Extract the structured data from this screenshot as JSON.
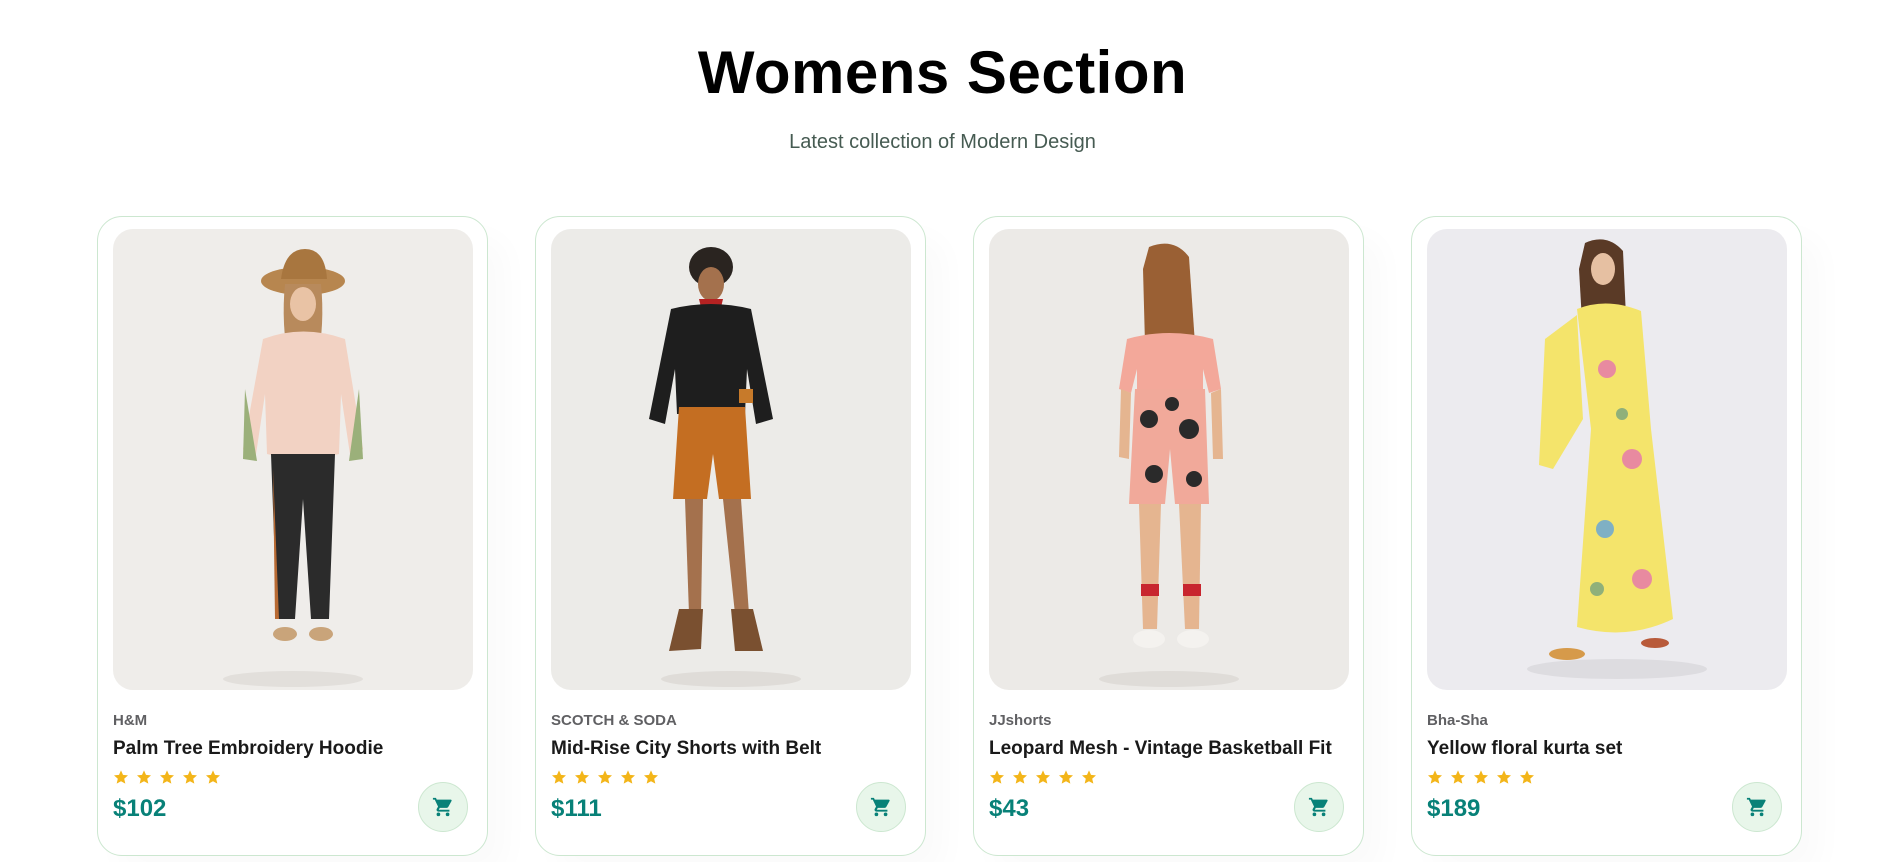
{
  "section": {
    "title": "Womens Section",
    "subtitle": "Latest collection of Modern Design"
  },
  "colors": {
    "accent": "#088178",
    "star": "#f3b519",
    "card_border": "#cce7d0",
    "cart_bg": "#e8f6ea"
  },
  "products": [
    {
      "brand": "H&M",
      "name": "Palm Tree Embroidery Hoodie",
      "rating": 5,
      "price": "$102",
      "image": "woman-in-hat-pink-hoodie-floral-pants",
      "cart_icon": "cart-icon"
    },
    {
      "brand": "SCOTCH & SODA",
      "name": "Mid-Rise City Shorts with Belt",
      "rating": 5,
      "price": "$111",
      "image": "woman-black-jacket-orange-shorts",
      "cart_icon": "cart-icon"
    },
    {
      "brand": "JJshorts",
      "name": "Leopard Mesh - Vintage Basketball Fit",
      "rating": 5,
      "price": "$43",
      "image": "woman-back-view-pink-tee-floral-shorts",
      "cart_icon": "cart-icon"
    },
    {
      "brand": "Bha-Sha",
      "name": "Yellow floral kurta set",
      "rating": 5,
      "price": "$189",
      "image": "woman-yellow-floral-dress",
      "cart_icon": "cart-icon"
    }
  ]
}
